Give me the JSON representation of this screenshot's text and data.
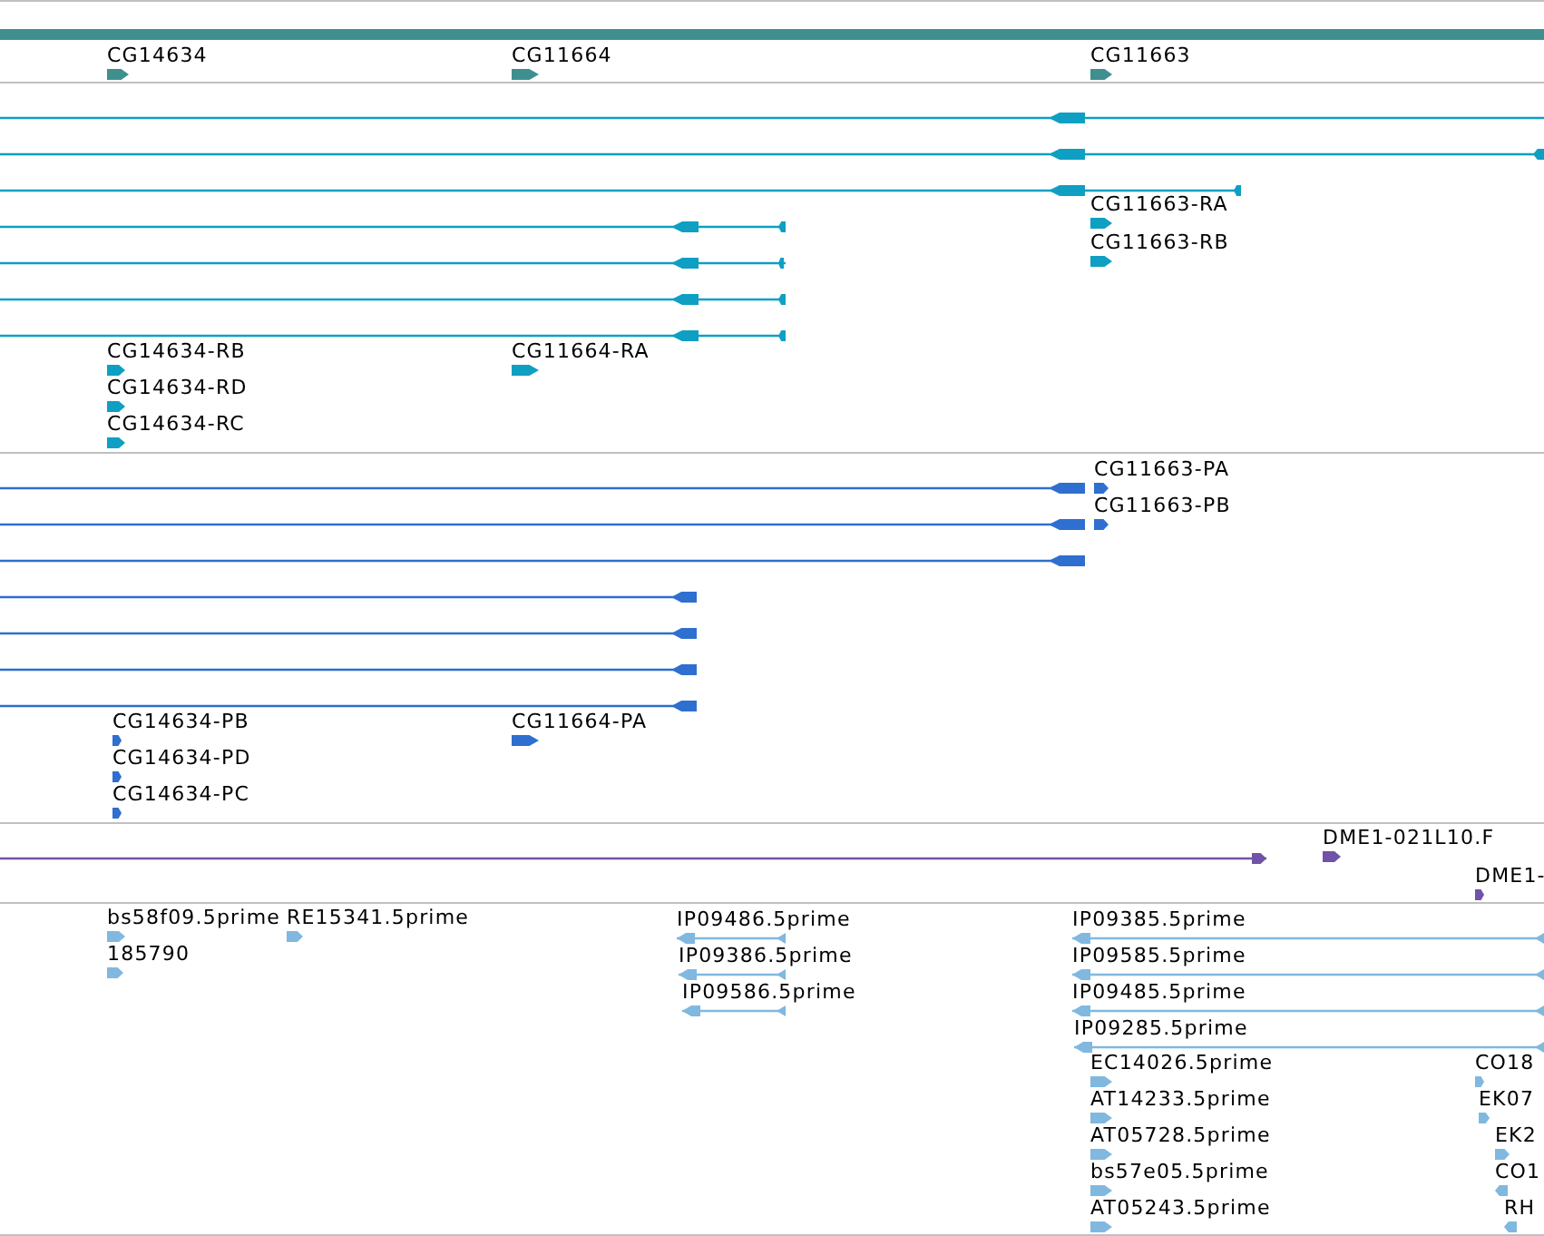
{
  "tracks": [
    {
      "kind": "genes",
      "color": "#3f8f8f",
      "features": [
        {
          "label": "CG14634",
          "reverse": false
        },
        {
          "label": "CG11664",
          "reverse": false
        },
        {
          "label": "CG11663",
          "reverse": false
        }
      ]
    },
    {
      "kind": "transcripts",
      "color": "#0e9fc3",
      "features": [
        {
          "label": "CG11663-RA",
          "reverse": false
        },
        {
          "label": "CG11663-RB",
          "reverse": false
        },
        {
          "label": "CG14634-RB",
          "reverse": false
        },
        {
          "label": "CG14634-RD",
          "reverse": false
        },
        {
          "label": "CG14634-RC",
          "reverse": false
        },
        {
          "label": "CG11664-RA",
          "reverse": false
        }
      ]
    },
    {
      "kind": "transcripts",
      "color": "#2e6fd0",
      "features": [
        {
          "label": "CG11663-PA",
          "reverse": false
        },
        {
          "label": "CG11663-PB",
          "reverse": false
        },
        {
          "label": "CG14634-PB",
          "reverse": false
        },
        {
          "label": "CG14634-PD",
          "reverse": false
        },
        {
          "label": "CG14634-PC",
          "reverse": false
        },
        {
          "label": "CG11664-PA",
          "reverse": false
        }
      ]
    },
    {
      "kind": "clones",
      "color": "#7052a8",
      "features": [
        {
          "label": "DME1-021L10.F",
          "reverse": false
        },
        {
          "label": "DME1-",
          "reverse": false
        }
      ]
    },
    {
      "kind": "ests",
      "color": "#80b8e0",
      "features": [
        {
          "label": "bs58f09.5prime",
          "reverse": false
        },
        {
          "label": "RE15341.5prime",
          "reverse": false
        },
        {
          "label": "185790",
          "reverse": false
        },
        {
          "label": "IP09486.5prime",
          "reverse": true
        },
        {
          "label": "IP09386.5prime",
          "reverse": true
        },
        {
          "label": "IP09586.5prime",
          "reverse": true
        },
        {
          "label": "IP09385.5prime",
          "reverse": true
        },
        {
          "label": "IP09585.5prime",
          "reverse": true
        },
        {
          "label": "IP09485.5prime",
          "reverse": true
        },
        {
          "label": "IP09285.5prime",
          "reverse": true
        },
        {
          "label": "EC14026.5prime",
          "reverse": false
        },
        {
          "label": "AT14233.5prime",
          "reverse": false
        },
        {
          "label": "AT05728.5prime",
          "reverse": false
        },
        {
          "label": "bs57e05.5prime",
          "reverse": false
        },
        {
          "label": "AT05243.5prime",
          "reverse": false
        },
        {
          "label": "CO18",
          "reverse": false
        },
        {
          "label": "EK07",
          "reverse": false
        },
        {
          "label": "EK2",
          "reverse": false
        },
        {
          "label": "CO1",
          "reverse": true
        },
        {
          "label": "RH",
          "reverse": true
        }
      ]
    }
  ]
}
